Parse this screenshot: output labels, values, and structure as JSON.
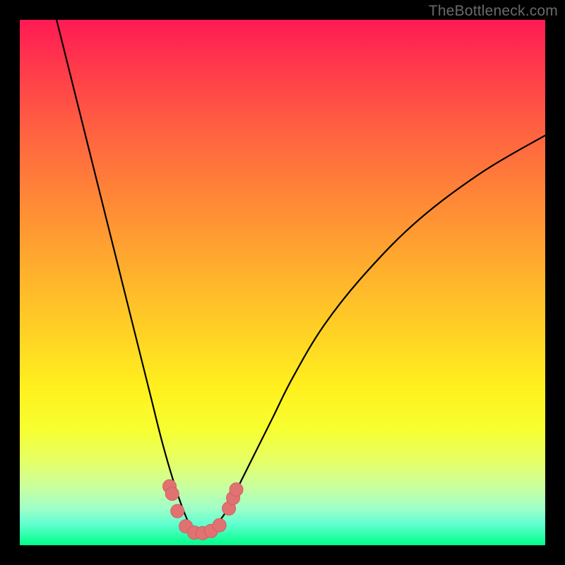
{
  "watermark": "TheBottleneck.com",
  "colors": {
    "curve_stroke": "#000000",
    "marker_fill": "#e07272",
    "marker_stroke": "#d55f5f"
  },
  "chart_data": {
    "type": "line",
    "title": "",
    "xlabel": "",
    "ylabel": "",
    "xlim": [
      0,
      100
    ],
    "ylim": [
      0,
      100
    ],
    "description": "V-shaped bottleneck curve with minimum near x≈34; curve descends steeply from top-left, bottoms out near the baseline, then rises toward upper-right. Salmon markers cluster along the trough.",
    "series": [
      {
        "name": "curve",
        "x": [
          7,
          9,
          11,
          13,
          15,
          17,
          19,
          21,
          23,
          25,
          27,
          29,
          31,
          33,
          34,
          35,
          36,
          37,
          39,
          41,
          44,
          48,
          52,
          58,
          66,
          76,
          88,
          100
        ],
        "y": [
          100,
          92,
          84,
          76,
          68,
          60,
          52,
          44,
          36,
          28,
          20,
          13,
          7,
          2.6,
          2,
          2.2,
          2.8,
          3.6,
          6,
          10,
          16,
          24,
          32,
          42,
          52,
          62,
          71,
          78
        ]
      }
    ],
    "markers": [
      {
        "x": 28.5,
        "y": 11.2
      },
      {
        "x": 29.0,
        "y": 9.8
      },
      {
        "x": 30.0,
        "y": 6.5
      },
      {
        "x": 31.6,
        "y": 3.6
      },
      {
        "x": 33.2,
        "y": 2.4
      },
      {
        "x": 34.8,
        "y": 2.3
      },
      {
        "x": 36.4,
        "y": 2.7
      },
      {
        "x": 38.0,
        "y": 3.8
      },
      {
        "x": 39.8,
        "y": 7.0
      },
      {
        "x": 40.6,
        "y": 9.0
      },
      {
        "x": 41.2,
        "y": 10.6
      }
    ]
  }
}
